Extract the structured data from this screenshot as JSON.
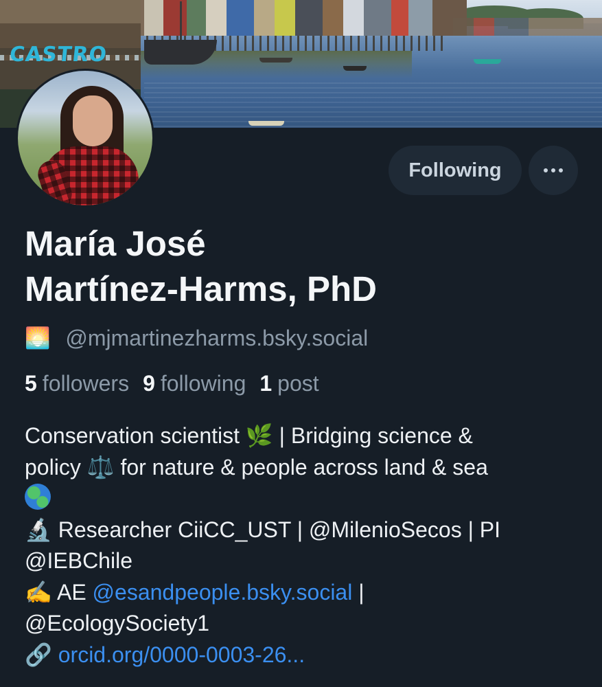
{
  "banner": {
    "sign_text": "CASTRO"
  },
  "profile": {
    "name_line1": "María José",
    "name_line2": "Martínez-Harms, PhD",
    "handle_emoji": "🌅",
    "handle": "@mjmartinezharms.bsky.social"
  },
  "actions": {
    "follow_label": "Following",
    "more_icon": "ellipsis-icon"
  },
  "stats": {
    "followers_count": "5",
    "followers_label": "followers",
    "following_count": "9",
    "following_label": "following",
    "posts_count": "1",
    "posts_label": "post"
  },
  "bio": {
    "l1_text": "Conservation scientist ",
    "l1_emoji": "🌿",
    "l1_rest": " | Bridging science &",
    "l2_text": "policy ",
    "l2_emoji": "⚖️",
    "l2_rest": " for nature & people across land & sea",
    "l3_emoji": "🌍",
    "l4_emoji": "🔬",
    "l4_text": " Researcher CiiCC_UST | @MilenioSecos | PI",
    "l5_text": "@IEBChile",
    "l6_emoji": "✍️",
    "l6_text": " AE ",
    "l6_link": "@esandpeople.bsky.social",
    "l6_rest": " |",
    "l7_text": "@EcologySociety1",
    "l8_emoji": "🔗",
    "l8_link": "orcid.org/0000-0003-26..."
  },
  "colors": {
    "background": "#161e27",
    "text_primary": "#f4f6f8",
    "text_secondary": "#8c9aa8",
    "link": "#3b8ff0",
    "button_bg": "#1f2a36"
  }
}
